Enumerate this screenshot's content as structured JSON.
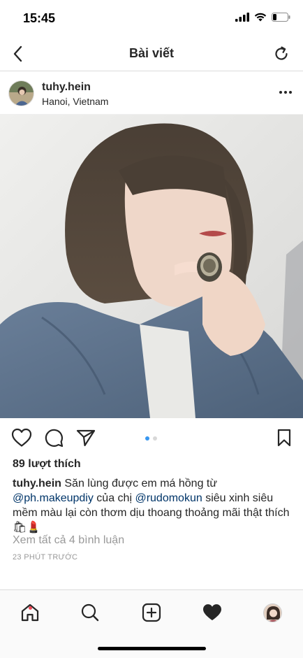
{
  "status": {
    "time": "15:45"
  },
  "nav": {
    "title": "Bài viết"
  },
  "post": {
    "username": "tuhy.hein",
    "location": "Hanoi, Vietnam",
    "likes": "89 lượt thích",
    "caption": {
      "username": "tuhy.hein",
      "part1": " Săn lùng được em má hồng từ ",
      "mention1": "@ph.makeupdiy",
      "part2": " của chị ",
      "mention2": "@rudomokun",
      "part3": " siêu xinh siêu mềm màu lại còn thơm dịu thoang thoảng mãi thật thích 🛍💄"
    },
    "view_comments": "Xem tất cả 4 bình luận",
    "time_ago": "23 PHÚT TRƯỚC",
    "carousel": {
      "total": 2,
      "active": 1
    }
  },
  "colors": {
    "accent": "#3897f0",
    "mention": "#003569",
    "muted": "#999999",
    "notification": "#ed4956"
  }
}
